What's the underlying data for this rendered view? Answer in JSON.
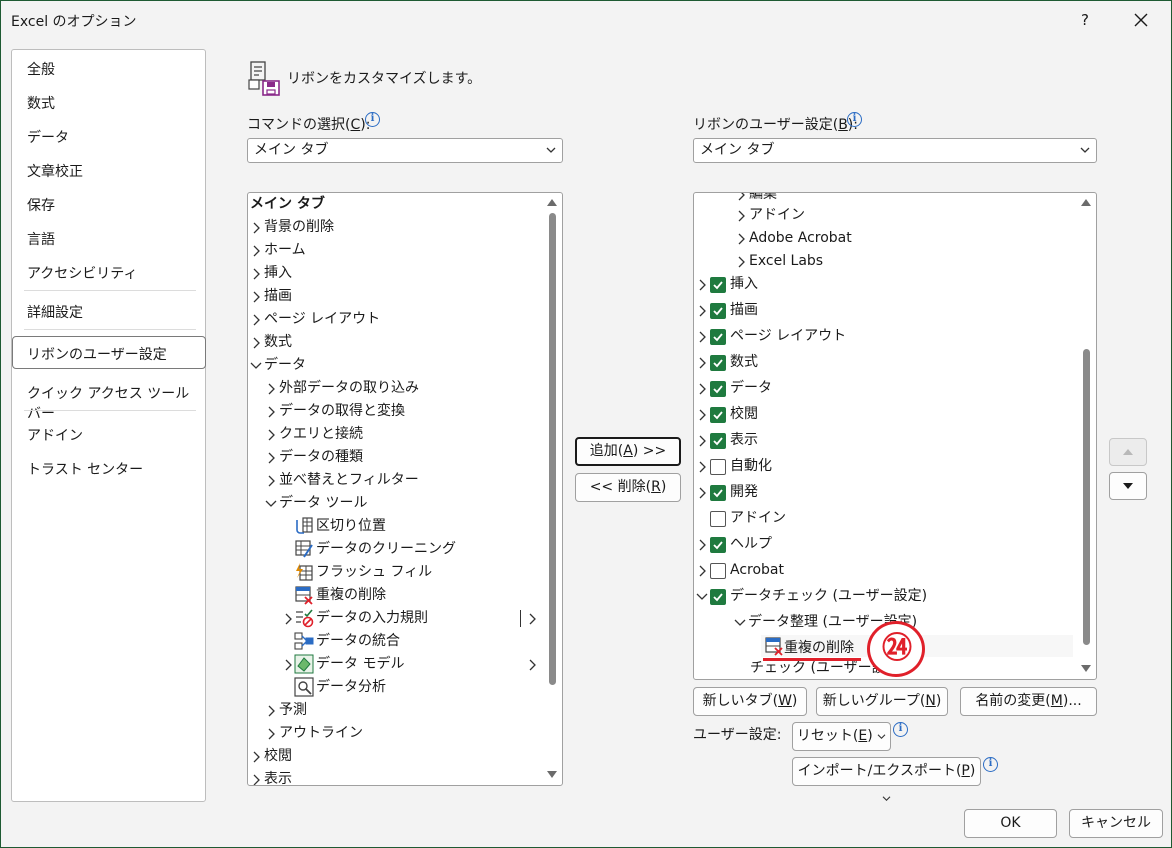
{
  "window": {
    "title": "Excel のオプション",
    "help": "?"
  },
  "nav": {
    "items": [
      "全般",
      "数式",
      "データ",
      "文章校正",
      "保存",
      "言語",
      "アクセシビリティ",
      "詳細設定",
      "リボンのユーザー設定",
      "クイック アクセス ツール バー",
      "アドイン",
      "トラスト センター"
    ],
    "selected": "リボンのユーザー設定"
  },
  "header": {
    "text": "リボンをカスタマイズします。"
  },
  "left": {
    "label_pre": "コマンドの選択(",
    "label_key": "C",
    "label_post": "):",
    "combo_value": "メイン タブ",
    "tree": {
      "r0": "メイン タブ",
      "r1": "背景の削除",
      "r2": "ホーム",
      "r3": "挿入",
      "r4": "描画",
      "r5": "ページ レイアウト",
      "r6": "数式",
      "r7": "データ",
      "r8": "外部データの取り込み",
      "r9": "データの取得と変換",
      "r10": "クエリと接続",
      "r11": "データの種類",
      "r12": "並べ替えとフィルター",
      "r13": "データ ツール",
      "r14": "区切り位置",
      "r15": "データのクリーニング",
      "r16": "フラッシュ フィル",
      "r17": "重複の削除",
      "r18": "データの入力規則",
      "r19": "データの統合",
      "r20": "データ モデル",
      "r21": "データ分析",
      "r22": "予測",
      "r23": "アウトライン",
      "r24": "校閲",
      "r25": "表示"
    }
  },
  "middle": {
    "add_pre": "追加(",
    "add_key": "A",
    "add_post": ") >>",
    "remove_pre": "<< 削除(",
    "remove_key": "R",
    "remove_post": ")"
  },
  "right": {
    "label_pre": "リボンのユーザー設定(",
    "label_key": "B",
    "label_post": "):",
    "combo_value": "メイン タブ",
    "tree": {
      "r0": "編集",
      "r1": "アドイン",
      "r2": "Adobe Acrobat",
      "r3": "Excel Labs",
      "r4": "挿入",
      "r5": "描画",
      "r6": "ページ レイアウト",
      "r7": "数式",
      "r8": "データ",
      "r9": "校閲",
      "r10": "表示",
      "r11": "自動化",
      "r12": "開発",
      "r13": "アドイン",
      "r14": "ヘルプ",
      "r15": "Acrobat",
      "r16": "データチェック (ユーザー設定)",
      "r17": "データ整理 (ユーザー設定)",
      "r18": "重複の削除",
      "r19": "チェック (ユーザー設定)"
    },
    "checked": {
      "挿入": true,
      "描画": true,
      "ページ レイアウト": true,
      "数式": true,
      "データ": true,
      "校閲": true,
      "表示": true,
      "自動化": false,
      "開発": true,
      "アドイン": false,
      "ヘルプ": true,
      "Acrobat": false,
      "データチェック (ユーザー設定)": true
    }
  },
  "bottom": {
    "new_tab_pre": "新しいタブ(",
    "new_tab_key": "W",
    "new_tab_post": ")",
    "new_group_pre": "新しいグループ(",
    "new_group_key": "N",
    "new_group_post": ")",
    "rename_pre": "名前の変更(",
    "rename_key": "M",
    "rename_post": ")...",
    "user_settings_label": "ユーザー設定:",
    "reset_pre": "リセット(",
    "reset_key": "E",
    "reset_post": ")",
    "import_pre": "インポート/エクスポート(",
    "import_key": "P",
    "import_post": ")",
    "ok": "OK",
    "cancel": "キャンセル"
  },
  "annotation": {
    "badge": "㉔",
    "color": "#e0202a"
  },
  "colors": {
    "check_green": "#1f7a3f",
    "info_blue": "#2b6cc4"
  }
}
